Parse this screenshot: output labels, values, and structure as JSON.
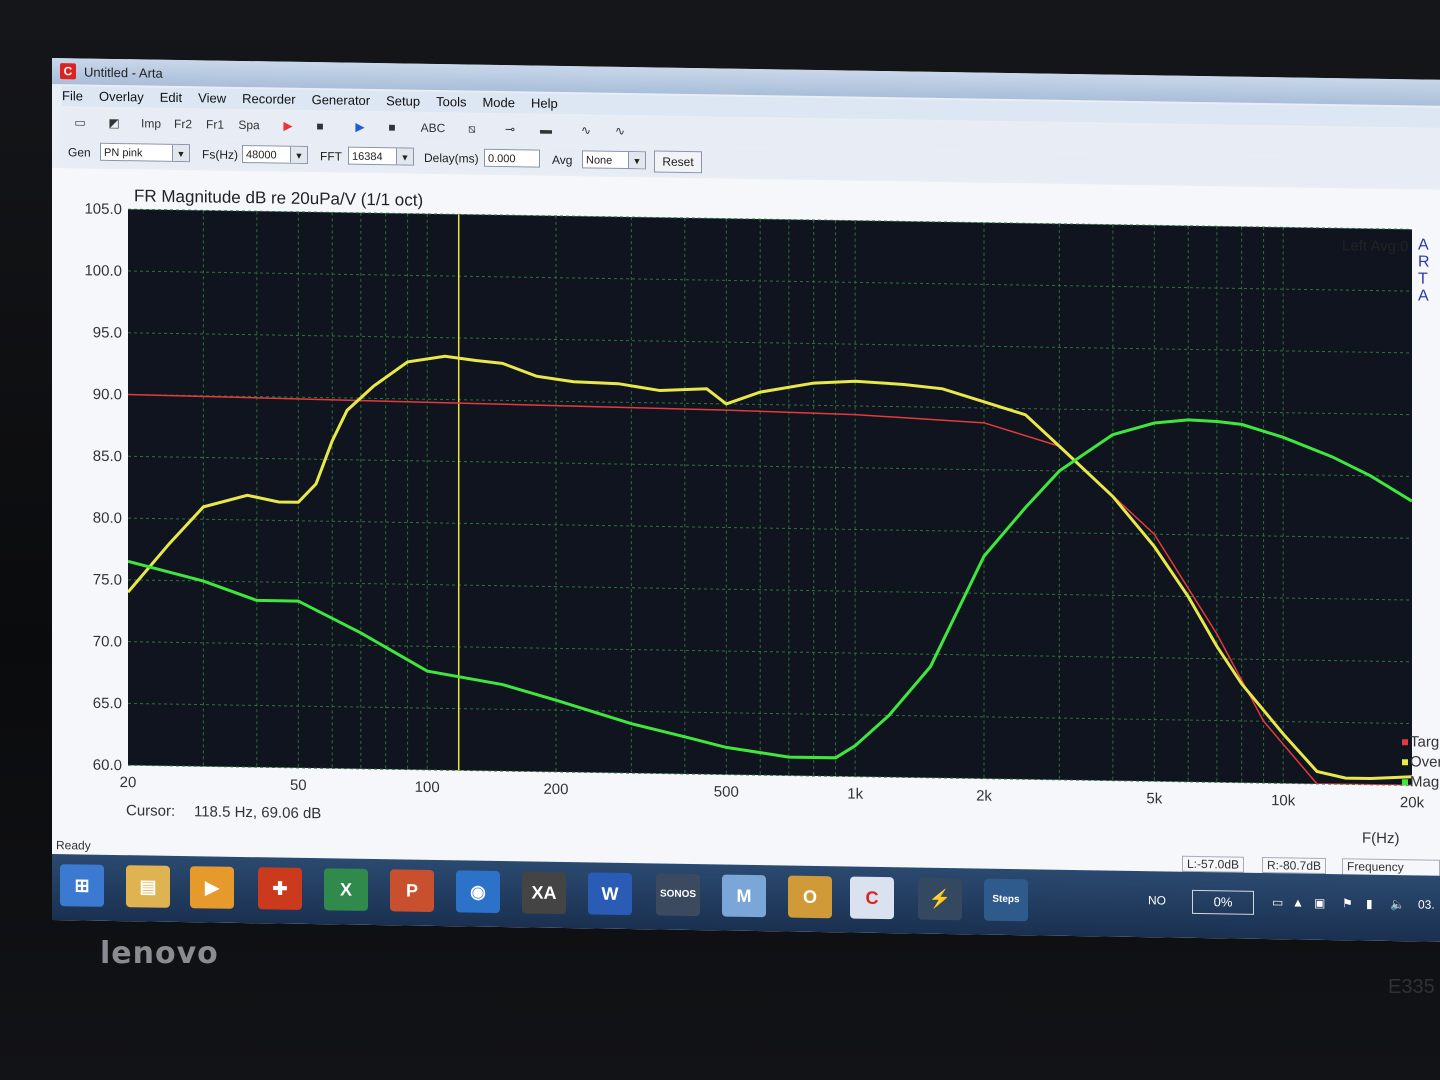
{
  "device": {
    "brand": "lenovo",
    "model": "E335"
  },
  "window": {
    "title": "Untitled - Arta",
    "app_icon": "C",
    "menus": [
      "File",
      "Overlay",
      "Edit",
      "View",
      "Recorder",
      "Generator",
      "Setup",
      "Tools",
      "Mode",
      "Help"
    ]
  },
  "toolbar": {
    "buttons": [
      {
        "name": "new-icon",
        "label": "▭"
      },
      {
        "name": "open-icon",
        "label": "◩"
      },
      {
        "name": "imp-button",
        "label": "Imp"
      },
      {
        "name": "fr2-button",
        "label": "Fr2"
      },
      {
        "name": "fr1-button",
        "label": "Fr1"
      },
      {
        "name": "spa-button",
        "label": "Spa"
      },
      {
        "name": "record-icon",
        "label": "▶"
      },
      {
        "name": "stop-icon",
        "label": "■"
      },
      {
        "name": "play-icon",
        "label": "▶"
      },
      {
        "name": "stop2-icon",
        "label": "■"
      },
      {
        "name": "abc-icon",
        "label": "ABC"
      },
      {
        "name": "cut-icon",
        "label": "⧅"
      },
      {
        "name": "cable-icon",
        "label": "⊸"
      },
      {
        "name": "card-icon",
        "label": "▬"
      },
      {
        "name": "wave-icon",
        "label": "∿"
      },
      {
        "name": "scope-icon",
        "label": "∿"
      }
    ]
  },
  "options": {
    "gen_label": "Gen",
    "gen_value": "PN pink",
    "fs_label": "Fs(Hz)",
    "fs_value": "48000",
    "fft_label": "FFT",
    "fft_value": "16384",
    "delay_label": "Delay(ms)",
    "delay_value": "0.000",
    "avg_label": "Avg",
    "avg_value": "None",
    "reset_label": "Reset"
  },
  "plot": {
    "cursor_label": "Cursor:",
    "cursor_value": "118.5 Hz, 69.06 dB",
    "channel_info": "Left  Avg:0",
    "side_brand": [
      "A",
      "R",
      "T",
      "A"
    ],
    "xunit": "F(Hz)",
    "legend": [
      {
        "text": "Targ",
        "color": "#e23b3b"
      },
      {
        "text": "Over",
        "color": "#e8e84a"
      },
      {
        "text": "Magi",
        "color": "#3ee63e"
      }
    ]
  },
  "chart_data": {
    "type": "line",
    "title": "FR Magnitude dB re 20uPa/V (1/1 oct)",
    "xlabel": "F(Hz)",
    "ylabel": "",
    "xscale": "log",
    "xlim": [
      20,
      20000
    ],
    "ylim": [
      60,
      105
    ],
    "xticks": [
      {
        "v": 20,
        "t": "20"
      },
      {
        "v": 50,
        "t": "50"
      },
      {
        "v": 100,
        "t": "100"
      },
      {
        "v": 200,
        "t": "200"
      },
      {
        "v": 500,
        "t": "500"
      },
      {
        "v": 1000,
        "t": "1k"
      },
      {
        "v": 2000,
        "t": "2k"
      },
      {
        "v": 5000,
        "t": "5k"
      },
      {
        "v": 10000,
        "t": "10k"
      },
      {
        "v": 20000,
        "t": "20k"
      }
    ],
    "yticks": [
      "105.0",
      "100.0",
      "95.0",
      "90.0",
      "85.0",
      "80.0",
      "75.0",
      "70.0",
      "65.0",
      "60.0"
    ],
    "cursor_x": 118.5,
    "colors": {
      "background": "#10141f",
      "grid": "#2f6f3a",
      "cursor": "#e8e83a"
    },
    "series": [
      {
        "color": "#e23b3b",
        "x": [
          20,
          500,
          1000,
          2000,
          3000,
          5000,
          7000,
          9000,
          12000,
          20000
        ],
        "y": [
          90,
          89.5,
          89.3,
          88.8,
          87,
          80,
          72,
          65,
          60,
          60
        ]
      },
      {
        "color": "#e8e84a",
        "x": [
          20,
          25,
          30,
          38,
          45,
          50,
          55,
          60,
          65,
          75,
          90,
          110,
          130,
          150,
          180,
          220,
          280,
          350,
          450,
          500,
          600,
          800,
          1000,
          1300,
          1600,
          2000,
          2500,
          3000,
          4000,
          5000,
          6000,
          7000,
          8000,
          10000,
          12000,
          14000,
          16000,
          20000
        ],
        "y": [
          74,
          78,
          81,
          82,
          81.5,
          81.5,
          83,
          86.5,
          89,
          91,
          93,
          93.5,
          93.2,
          93,
          92,
          91.6,
          91.5,
          91,
          91.2,
          90,
          91,
          91.8,
          92,
          91.8,
          91.5,
          90.5,
          89.5,
          87,
          83,
          79,
          75,
          71,
          68,
          64,
          61,
          60.5,
          60.5,
          60.7
        ]
      },
      {
        "color": "#3ee63e",
        "x": [
          20,
          30,
          40,
          50,
          70,
          100,
          150,
          200,
          300,
          400,
          500,
          700,
          900,
          1000,
          1200,
          1500,
          2000,
          2500,
          3000,
          4000,
          5000,
          6000,
          7000,
          8000,
          10000,
          13000,
          16000,
          20000
        ],
        "y": [
          76.5,
          75,
          73.5,
          73.5,
          71,
          68,
          67,
          65.8,
          64,
          63,
          62.2,
          61.5,
          61.5,
          62.5,
          65,
          69,
          78,
          82,
          85,
          88,
          89,
          89.3,
          89.2,
          89,
          88,
          86.5,
          85,
          83
        ]
      }
    ]
  },
  "status": {
    "ready": "Ready",
    "left_level": "L:-57.0dB",
    "right_level": "R:-80.7dB",
    "mode": "Frequency respo"
  },
  "taskbar": {
    "apps": [
      {
        "name": "start-orb-icon",
        "label": "⊞",
        "color": "#3b7ad0"
      },
      {
        "name": "explorer-icon",
        "label": "▤",
        "color": "#e0b352"
      },
      {
        "name": "media-player-icon",
        "label": "▶",
        "color": "#e69a2b"
      },
      {
        "name": "app-red-icon",
        "label": "✚",
        "color": "#cc3a1e"
      },
      {
        "name": "excel-icon",
        "label": "X",
        "color": "#2f8a4b"
      },
      {
        "name": "powerpoint-icon",
        "label": "P",
        "color": "#c8502e"
      },
      {
        "name": "wmp-icon",
        "label": "◉",
        "color": "#2d72c9"
      },
      {
        "name": "xa-icon",
        "label": "XA",
        "color": "#444"
      },
      {
        "name": "word-icon",
        "label": "W",
        "color": "#2b5cb5"
      },
      {
        "name": "sonos-icon",
        "label": "SONOS",
        "color": "#3b4a5e"
      },
      {
        "name": "m-icon",
        "label": "M",
        "color": "#7aa6d8"
      },
      {
        "name": "outlook-icon",
        "label": "O",
        "color": "#d09a38"
      },
      {
        "name": "arta-icon",
        "label": "C",
        "color": "#d9e2ee"
      },
      {
        "name": "bolt-icon",
        "label": "⚡",
        "color": "#34485f"
      },
      {
        "name": "steps-icon",
        "label": "Steps",
        "color": "#2f5a8c"
      }
    ],
    "lang": "NO",
    "battery": "0%",
    "clock": "03."
  }
}
